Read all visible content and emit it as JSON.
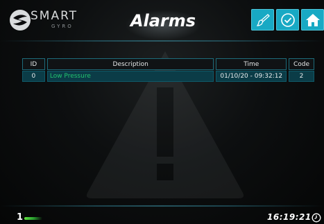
{
  "header": {
    "logo_text": "SMART",
    "logo_sub": "GYRO",
    "title": "Alarms",
    "buttons": [
      {
        "name": "brush",
        "icon": "brush-icon"
      },
      {
        "name": "acknowledge",
        "icon": "check-circle-icon"
      },
      {
        "name": "home",
        "icon": "home-icon"
      }
    ]
  },
  "colors": {
    "accent": "#18a9c4",
    "row_bg": "#0b3c47",
    "alarm_text": "#22c46f"
  },
  "table": {
    "headers": [
      "ID",
      "Description",
      "Time",
      "Code"
    ],
    "rows": [
      {
        "id": "0",
        "description": "Low Pressure",
        "time": "01/10/20 - 09:32:12",
        "code": "2"
      }
    ]
  },
  "footer": {
    "page": "1",
    "time": "16:19:21"
  }
}
